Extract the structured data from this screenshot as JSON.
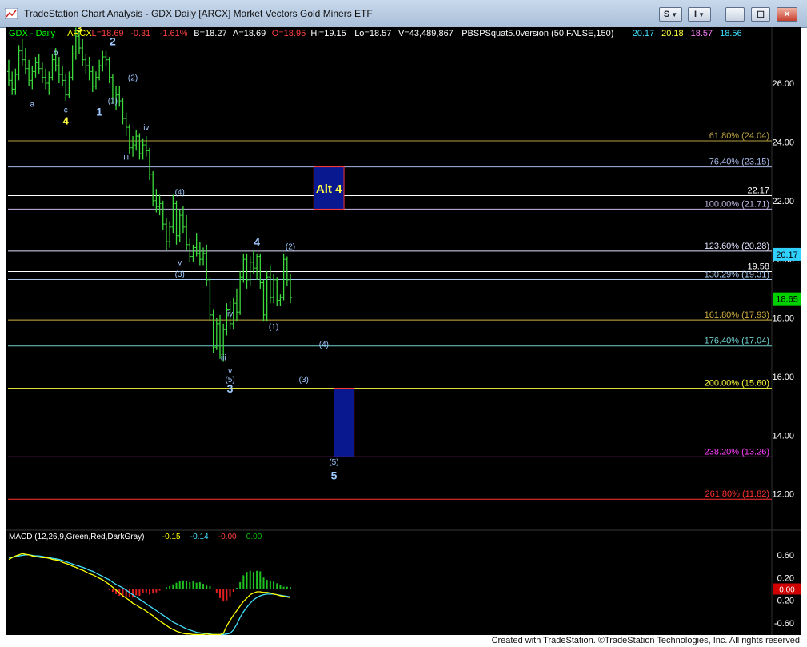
{
  "window": {
    "title": "TradeStation Chart Analysis - GDX Daily [ARCX] Market Vectors Gold Miners ETF",
    "buttons": [
      "S",
      "I",
      "_",
      "☐",
      "×"
    ],
    "icon": "chart-app-icon"
  },
  "header": {
    "parts": [
      {
        "text": "GDX - Daily",
        "color": "#00ff00"
      },
      {
        "text": "ARCX",
        "color": "#ffff00"
      },
      {
        "text": "L=18.69",
        "color": "#ff4040"
      },
      {
        "text": "-0.31",
        "color": "#ff4040"
      },
      {
        "text": "-1.61%",
        "color": "#ff4040"
      },
      {
        "text": "B=18.27",
        "color": "#ffffff"
      },
      {
        "text": "A=18.69",
        "color": "#ffffff"
      },
      {
        "text": "O=18.95",
        "color": "#ff4040"
      },
      {
        "text": "Hi=19.15",
        "color": "#ffffff"
      },
      {
        "text": "Lo=18.57",
        "color": "#ffffff"
      },
      {
        "text": "V=43,489,867",
        "color": "#ffffff"
      },
      {
        "text": "PBSPSquat5.0version (50,FALSE,150)",
        "color": "#ffffff"
      },
      {
        "text": "20.17",
        "color": "#40e0ff"
      },
      {
        "text": "20.18",
        "color": "#ffff40"
      },
      {
        "text": "18.57",
        "color": "#ff80ff"
      },
      {
        "text": "18.56",
        "color": "#40e0ff"
      }
    ]
  },
  "macd_header": {
    "parts": [
      {
        "text": "MACD (12,26,9,Green,Red,DarkGray)",
        "color": "#ffffff"
      },
      {
        "text": "-0.15",
        "color": "#ffff00"
      },
      {
        "text": "-0.14",
        "color": "#40e0ff"
      },
      {
        "text": "-0.00",
        "color": "#ff4040"
      },
      {
        "text": "0.00",
        "color": "#00c000"
      }
    ]
  },
  "chart_data": {
    "type": "candlestick",
    "symbol": "GDX",
    "interval": "Daily",
    "price_axis": {
      "ticks": [
        "26.00",
        "24.00",
        "22.00",
        "20.00",
        "18.00",
        "16.00",
        "14.00",
        "12.00"
      ],
      "range": [
        10.9,
        27.8
      ]
    },
    "last_price_tags": [
      {
        "value": 20.17,
        "label": "20.17",
        "bg": "#30d0ff"
      },
      {
        "value": 18.65,
        "label": "18.65",
        "bg": "#00d000"
      }
    ],
    "price_series": [
      {
        "o": 26.4,
        "h": 26.8,
        "l": 25.9,
        "c": 26.1
      },
      {
        "o": 26.1,
        "h": 26.4,
        "l": 25.6,
        "c": 25.8
      },
      {
        "o": 25.8,
        "h": 26.5,
        "l": 25.6,
        "c": 26.3
      },
      {
        "o": 26.3,
        "h": 27.3,
        "l": 26.1,
        "c": 27.1
      },
      {
        "o": 27.1,
        "h": 27.5,
        "l": 26.6,
        "c": 26.8
      },
      {
        "o": 26.8,
        "h": 27.2,
        "l": 26.3,
        "c": 26.5
      },
      {
        "o": 26.5,
        "h": 26.8,
        "l": 25.9,
        "c": 26.1
      },
      {
        "o": 26.1,
        "h": 26.6,
        "l": 25.8,
        "c": 26.4
      },
      {
        "o": 26.4,
        "h": 26.9,
        "l": 26.2,
        "c": 26.7
      },
      {
        "o": 26.7,
        "h": 27.0,
        "l": 26.3,
        "c": 26.5
      },
      {
        "o": 26.5,
        "h": 26.7,
        "l": 26.0,
        "c": 26.2
      },
      {
        "o": 26.2,
        "h": 26.5,
        "l": 25.8,
        "c": 26.0
      },
      {
        "o": 26.0,
        "h": 26.4,
        "l": 25.6,
        "c": 26.2
      },
      {
        "o": 26.2,
        "h": 27.0,
        "l": 26.1,
        "c": 26.8
      },
      {
        "o": 26.8,
        "h": 27.2,
        "l": 26.4,
        "c": 26.6
      },
      {
        "o": 26.6,
        "h": 26.9,
        "l": 26.0,
        "c": 26.3
      },
      {
        "o": 26.3,
        "h": 26.6,
        "l": 25.9,
        "c": 26.1
      },
      {
        "o": 26.1,
        "h": 26.3,
        "l": 25.4,
        "c": 25.6
      },
      {
        "o": 25.6,
        "h": 26.4,
        "l": 25.5,
        "c": 26.2
      },
      {
        "o": 26.2,
        "h": 27.3,
        "l": 26.1,
        "c": 27.0
      },
      {
        "o": 27.0,
        "h": 27.9,
        "l": 26.8,
        "c": 27.6
      },
      {
        "o": 27.6,
        "h": 27.8,
        "l": 27.0,
        "c": 27.2
      },
      {
        "o": 27.2,
        "h": 27.5,
        "l": 26.6,
        "c": 26.8
      },
      {
        "o": 26.8,
        "h": 27.0,
        "l": 26.3,
        "c": 26.6
      },
      {
        "o": 26.6,
        "h": 26.9,
        "l": 26.1,
        "c": 26.4
      },
      {
        "o": 26.4,
        "h": 26.6,
        "l": 25.7,
        "c": 25.9
      },
      {
        "o": 25.9,
        "h": 26.4,
        "l": 25.8,
        "c": 26.2
      },
      {
        "o": 26.2,
        "h": 26.8,
        "l": 26.1,
        "c": 26.6
      },
      {
        "o": 26.6,
        "h": 27.1,
        "l": 26.4,
        "c": 26.9
      },
      {
        "o": 26.9,
        "h": 27.1,
        "l": 26.6,
        "c": 26.8
      },
      {
        "o": 26.8,
        "h": 26.9,
        "l": 26.0,
        "c": 26.2
      },
      {
        "o": 26.2,
        "h": 26.3,
        "l": 25.3,
        "c": 25.5
      },
      {
        "o": 25.5,
        "h": 25.9,
        "l": 25.1,
        "c": 25.6
      },
      {
        "o": 25.6,
        "h": 25.9,
        "l": 25.2,
        "c": 25.4
      },
      {
        "o": 25.4,
        "h": 25.5,
        "l": 24.6,
        "c": 24.8
      },
      {
        "o": 24.8,
        "h": 25.0,
        "l": 24.2,
        "c": 24.5
      },
      {
        "o": 24.5,
        "h": 24.6,
        "l": 23.6,
        "c": 23.8
      },
      {
        "o": 23.8,
        "h": 24.2,
        "l": 23.5,
        "c": 23.9
      },
      {
        "o": 23.9,
        "h": 24.4,
        "l": 23.7,
        "c": 24.2
      },
      {
        "o": 24.2,
        "h": 24.3,
        "l": 23.4,
        "c": 23.6
      },
      {
        "o": 23.6,
        "h": 24.1,
        "l": 23.4,
        "c": 23.9
      },
      {
        "o": 23.9,
        "h": 24.2,
        "l": 23.5,
        "c": 23.7
      },
      {
        "o": 23.7,
        "h": 23.8,
        "l": 22.7,
        "c": 22.9
      },
      {
        "o": 22.9,
        "h": 23.0,
        "l": 21.8,
        "c": 22.0
      },
      {
        "o": 22.0,
        "h": 22.4,
        "l": 21.6,
        "c": 21.8
      },
      {
        "o": 21.8,
        "h": 22.2,
        "l": 21.5,
        "c": 21.9
      },
      {
        "o": 21.9,
        "h": 22.0,
        "l": 21.0,
        "c": 21.2
      },
      {
        "o": 21.2,
        "h": 21.4,
        "l": 20.3,
        "c": 20.6
      },
      {
        "o": 20.6,
        "h": 21.3,
        "l": 20.4,
        "c": 21.1
      },
      {
        "o": 21.1,
        "h": 22.2,
        "l": 20.9,
        "c": 21.9
      },
      {
        "o": 21.9,
        "h": 22.0,
        "l": 20.5,
        "c": 20.8
      },
      {
        "o": 20.8,
        "h": 21.7,
        "l": 20.6,
        "c": 21.5
      },
      {
        "o": 21.5,
        "h": 21.8,
        "l": 20.9,
        "c": 21.1
      },
      {
        "o": 21.1,
        "h": 21.5,
        "l": 20.3,
        "c": 20.5
      },
      {
        "o": 20.5,
        "h": 20.7,
        "l": 19.9,
        "c": 20.1
      },
      {
        "o": 20.1,
        "h": 20.5,
        "l": 19.9,
        "c": 20.4
      },
      {
        "o": 20.4,
        "h": 20.9,
        "l": 20.1,
        "c": 20.2
      },
      {
        "o": 20.2,
        "h": 20.6,
        "l": 19.8,
        "c": 20.0
      },
      {
        "o": 20.0,
        "h": 20.4,
        "l": 19.8,
        "c": 20.2
      },
      {
        "o": 20.2,
        "h": 20.5,
        "l": 19.1,
        "c": 19.3
      },
      {
        "o": 19.3,
        "h": 19.4,
        "l": 17.9,
        "c": 18.1
      },
      {
        "o": 18.1,
        "h": 18.3,
        "l": 16.8,
        "c": 17.0
      },
      {
        "o": 17.0,
        "h": 18.0,
        "l": 16.9,
        "c": 17.8
      },
      {
        "o": 17.8,
        "h": 18.1,
        "l": 16.6,
        "c": 16.8
      },
      {
        "o": 16.8,
        "h": 17.8,
        "l": 16.5,
        "c": 17.6
      },
      {
        "o": 17.6,
        "h": 18.5,
        "l": 17.4,
        "c": 18.3
      },
      {
        "o": 18.3,
        "h": 18.6,
        "l": 17.6,
        "c": 17.8
      },
      {
        "o": 17.8,
        "h": 18.7,
        "l": 17.6,
        "c": 18.5
      },
      {
        "o": 18.5,
        "h": 19.0,
        "l": 17.9,
        "c": 18.2
      },
      {
        "o": 18.2,
        "h": 19.6,
        "l": 18.1,
        "c": 19.4
      },
      {
        "o": 19.4,
        "h": 20.2,
        "l": 19.2,
        "c": 20.0
      },
      {
        "o": 20.0,
        "h": 20.2,
        "l": 19.0,
        "c": 19.3
      },
      {
        "o": 19.3,
        "h": 20.1,
        "l": 19.1,
        "c": 19.9
      },
      {
        "o": 19.9,
        "h": 20.3,
        "l": 19.5,
        "c": 19.7
      },
      {
        "o": 19.7,
        "h": 20.2,
        "l": 19.3,
        "c": 20.1
      },
      {
        "o": 20.1,
        "h": 20.2,
        "l": 19.0,
        "c": 19.2
      },
      {
        "o": 19.2,
        "h": 19.3,
        "l": 17.9,
        "c": 18.1
      },
      {
        "o": 18.1,
        "h": 19.6,
        "l": 17.9,
        "c": 19.4
      },
      {
        "o": 19.4,
        "h": 19.8,
        "l": 18.5,
        "c": 18.7
      },
      {
        "o": 18.7,
        "h": 19.5,
        "l": 18.5,
        "c": 19.3
      },
      {
        "o": 19.3,
        "h": 19.4,
        "l": 18.4,
        "c": 18.6
      },
      {
        "o": 18.6,
        "h": 18.8,
        "l": 18.4,
        "c": 18.7
      },
      {
        "o": 18.7,
        "h": 20.2,
        "l": 18.6,
        "c": 20.0
      },
      {
        "o": 20.0,
        "h": 20.1,
        "l": 19.1,
        "c": 19.3
      },
      {
        "o": 19.3,
        "h": 19.5,
        "l": 18.5,
        "c": 18.7
      }
    ],
    "fib_levels": [
      {
        "value": 24.04,
        "label": "61.80% (24.04)",
        "color": "#b8a040"
      },
      {
        "value": 23.15,
        "label": "76.40% (23.15)",
        "color": "#a8b8e8"
      },
      {
        "value": 22.17,
        "label": "22.17",
        "color": "#ffffff"
      },
      {
        "value": 21.71,
        "label": "100.00% (21.71)",
        "color": "#c8b8e8"
      },
      {
        "value": 20.28,
        "label": "123.60% (20.28)",
        "color": "#e0e0ff"
      },
      {
        "value": 19.58,
        "label": "19.58",
        "color": "#ffffff"
      },
      {
        "value": 19.31,
        "label": "130.29% (19.31)",
        "color": "#a8c8f0"
      },
      {
        "value": 17.93,
        "label": "161.80% (17.93)",
        "color": "#d0b040"
      },
      {
        "value": 17.04,
        "label": "176.40% (17.04)",
        "color": "#70d0d0"
      },
      {
        "value": 15.6,
        "label": "200.00% (15.60)",
        "color": "#ffff40"
      },
      {
        "value": 13.26,
        "label": "238.20% (13.26)",
        "color": "#ff40ff"
      },
      {
        "value": 11.82,
        "label": "261.80% (11.82)",
        "color": "#ff3030"
      }
    ],
    "target_boxes": [
      {
        "label": "Alt 4",
        "x_index": [
          91,
          100
        ],
        "y": [
          21.71,
          23.15
        ]
      },
      {
        "label": "",
        "x_index": [
          97,
          103
        ],
        "y": [
          13.26,
          15.6
        ]
      }
    ],
    "wave_labels": [
      {
        "text": "3",
        "i": 21,
        "y": 27.75,
        "color": "#ffff40",
        "size": 13
      },
      {
        "text": "b",
        "i": 14,
        "y": 26.95,
        "color": "#a0c8ff",
        "size": 10
      },
      {
        "text": "a",
        "i": 7,
        "y": 25.2,
        "color": "#a0c8ff",
        "size": 10
      },
      {
        "text": "c",
        "i": 17,
        "y": 25.0,
        "color": "#a0c8ff",
        "size": 10
      },
      {
        "text": "4",
        "i": 17,
        "y": 24.6,
        "color": "#ffff40",
        "size": 13
      },
      {
        "text": "1",
        "i": 27,
        "y": 24.9,
        "color": "#a0c8ff",
        "size": 14
      },
      {
        "text": "2",
        "i": 31,
        "y": 27.3,
        "color": "#a0c8ff",
        "size": 14
      },
      {
        "text": "(1)",
        "i": 31,
        "y": 25.3,
        "color": "#a0c8ff",
        "size": 10
      },
      {
        "text": "(2)",
        "i": 37,
        "y": 26.1,
        "color": "#a0c8ff",
        "size": 10
      },
      {
        "text": "iv",
        "i": 41,
        "y": 24.4,
        "color": "#a0c8ff",
        "size": 10
      },
      {
        "text": "iii",
        "i": 35,
        "y": 23.4,
        "color": "#a0c8ff",
        "size": 10
      },
      {
        "text": "(4)",
        "i": 51,
        "y": 22.2,
        "color": "#a0c8ff",
        "size": 10
      },
      {
        "text": "v",
        "i": 51,
        "y": 19.8,
        "color": "#a0c8ff",
        "size": 10
      },
      {
        "text": "(3)",
        "i": 51,
        "y": 19.4,
        "color": "#a0c8ff",
        "size": 10
      },
      {
        "text": "iv",
        "i": 66,
        "y": 18.05,
        "color": "#a0c8ff",
        "size": 10
      },
      {
        "text": "iii",
        "i": 64,
        "y": 16.55,
        "color": "#a0c8ff",
        "size": 10
      },
      {
        "text": "v",
        "i": 66,
        "y": 16.1,
        "color": "#a0c8ff",
        "size": 10
      },
      {
        "text": "(5)",
        "i": 66,
        "y": 15.8,
        "color": "#a0c8ff",
        "size": 10
      },
      {
        "text": "3",
        "i": 66,
        "y": 15.45,
        "color": "#a0c8ff",
        "size": 14
      },
      {
        "text": "4",
        "i": 74,
        "y": 20.45,
        "color": "#a0c8ff",
        "size": 14
      },
      {
        "text": "(2)",
        "i": 84,
        "y": 20.35,
        "color": "#a0c8ff",
        "size": 10
      },
      {
        "text": "(1)",
        "i": 79,
        "y": 17.6,
        "color": "#a0c8ff",
        "size": 10
      },
      {
        "text": "(4)",
        "i": 94,
        "y": 17.0,
        "color": "#a0c8ff",
        "size": 10
      },
      {
        "text": "(3)",
        "i": 88,
        "y": 15.8,
        "color": "#a0c8ff",
        "size": 10
      },
      {
        "text": "(5)",
        "i": 97,
        "y": 13.0,
        "color": "#a0c8ff",
        "size": 10
      },
      {
        "text": "5",
        "i": 97,
        "y": 12.5,
        "color": "#a0c8ff",
        "size": 14
      }
    ],
    "macd": {
      "axis_ticks": [
        "0.60",
        "0.20",
        "-0.20",
        "-0.60"
      ],
      "range": [
        -0.78,
        0.85
      ],
      "zero_tag": {
        "value": 0.0,
        "label": "0.00",
        "bg": "#d00000"
      },
      "histogram": [
        0.0,
        0.0,
        0.0,
        0.0,
        0.0,
        0.0,
        0.0,
        0.0,
        0.0,
        0.0,
        0.0,
        0.0,
        0.0,
        0.0,
        0.0,
        0.0,
        0.0,
        0.0,
        0.0,
        0.0,
        0.0,
        0.0,
        0.0,
        0.0,
        0.0,
        0.0,
        0.0,
        0.0,
        0.0,
        0.0,
        -0.02,
        -0.05,
        -0.09,
        -0.12,
        -0.15,
        -0.14,
        -0.14,
        -0.15,
        -0.11,
        -0.12,
        -0.07,
        -0.06,
        -0.1,
        -0.08,
        -0.06,
        -0.03,
        0.0,
        0.03,
        0.05,
        0.08,
        0.11,
        0.14,
        0.15,
        0.14,
        0.12,
        0.14,
        0.11,
        0.12,
        0.09,
        0.06,
        0.05,
        0.01,
        -0.07,
        -0.16,
        -0.22,
        -0.2,
        -0.13,
        -0.05,
        0.02,
        0.12,
        0.24,
        0.3,
        0.32,
        0.3,
        0.32,
        0.31,
        0.2,
        0.16,
        0.15,
        0.13,
        0.1,
        0.07,
        0.04,
        0.04,
        0.03
      ],
      "macd_line": [
        0.52,
        0.55,
        0.58,
        0.6,
        0.62,
        0.61,
        0.6,
        0.58,
        0.57,
        0.56,
        0.55,
        0.55,
        0.54,
        0.52,
        0.51,
        0.5,
        0.47,
        0.45,
        0.43,
        0.4,
        0.38,
        0.35,
        0.33,
        0.3,
        0.27,
        0.25,
        0.22,
        0.19,
        0.16,
        0.12,
        0.08,
        0.03,
        -0.02,
        -0.07,
        -0.12,
        -0.16,
        -0.2,
        -0.25,
        -0.28,
        -0.32,
        -0.35,
        -0.39,
        -0.43,
        -0.47,
        -0.52,
        -0.56,
        -0.6,
        -0.64,
        -0.68,
        -0.71,
        -0.74,
        -0.76,
        -0.78,
        -0.79,
        -0.79,
        -0.8,
        -0.8,
        -0.8,
        -0.8,
        -0.79,
        -0.8,
        -0.8,
        -0.8,
        -0.8,
        -0.78,
        -0.65,
        -0.55,
        -0.46,
        -0.38,
        -0.3,
        -0.22,
        -0.16,
        -0.1,
        -0.07,
        -0.05,
        -0.05,
        -0.06,
        -0.06,
        -0.07,
        -0.09,
        -0.1,
        -0.12,
        -0.13,
        -0.14,
        -0.15
      ],
      "signal_line": [
        0.55,
        0.56,
        0.57,
        0.58,
        0.59,
        0.6,
        0.6,
        0.59,
        0.58,
        0.58,
        0.57,
        0.56,
        0.55,
        0.54,
        0.53,
        0.52,
        0.5,
        0.48,
        0.46,
        0.44,
        0.42,
        0.4,
        0.38,
        0.36,
        0.33,
        0.31,
        0.28,
        0.25,
        0.22,
        0.19,
        0.16,
        0.12,
        0.08,
        0.05,
        0.02,
        -0.02,
        -0.06,
        -0.1,
        -0.14,
        -0.18,
        -0.22,
        -0.26,
        -0.3,
        -0.34,
        -0.38,
        -0.42,
        -0.46,
        -0.5,
        -0.54,
        -0.58,
        -0.61,
        -0.64,
        -0.67,
        -0.7,
        -0.72,
        -0.74,
        -0.76,
        -0.77,
        -0.78,
        -0.79,
        -0.79,
        -0.8,
        -0.8,
        -0.8,
        -0.8,
        -0.79,
        -0.78,
        -0.72,
        -0.62,
        -0.5,
        -0.4,
        -0.32,
        -0.25,
        -0.19,
        -0.15,
        -0.12,
        -0.1,
        -0.09,
        -0.09,
        -0.09,
        -0.1,
        -0.11,
        -0.12,
        -0.13,
        -0.14
      ]
    }
  },
  "footer": {
    "text": "Created with TradeStation. ©TradeStation Technologies, Inc. All rights reserved."
  }
}
